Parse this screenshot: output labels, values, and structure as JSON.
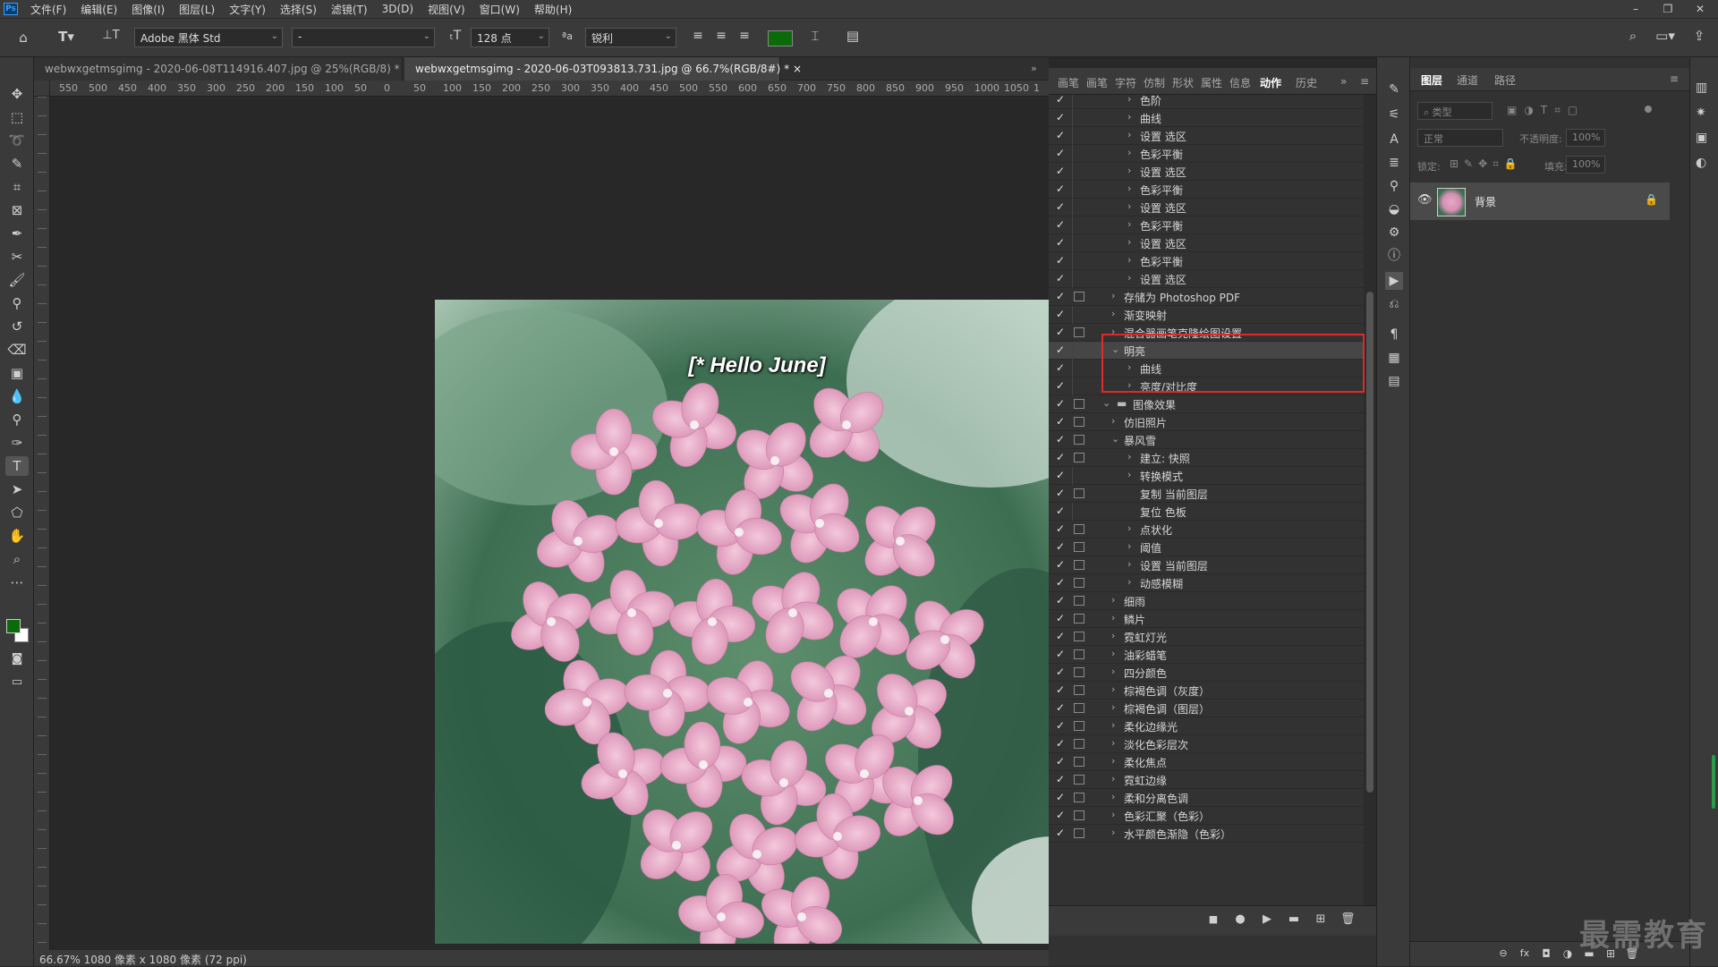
{
  "menubar": {
    "logo": "Ps",
    "items": [
      "文件(F)",
      "编辑(E)",
      "图像(I)",
      "图层(L)",
      "文字(Y)",
      "选择(S)",
      "滤镜(T)",
      "3D(D)",
      "视图(V)",
      "窗口(W)",
      "帮助(H)"
    ],
    "minimize": "–",
    "restore": "❐",
    "close": "✕"
  },
  "options": {
    "font_family": "Adobe 黑体 Std",
    "font_style": "-",
    "font_size": "128 点",
    "antialias_icon": "ªa",
    "antialias": "锐利",
    "text_color": "#0b6b0b"
  },
  "tabs": [
    {
      "label": "webwxgetmsgimg - 2020-06-08T114916.407.jpg @ 25%(RGB/8) *",
      "close": "×"
    },
    {
      "label": "webwxgetmsgimg - 2020-06-03T093813.731.jpg @ 66.7%(RGB/8#) *",
      "close": "×"
    }
  ],
  "ruler_h": [
    "550",
    "500",
    "450",
    "400",
    "350",
    "300",
    "250",
    "200",
    "150",
    "100",
    "50",
    "0",
    "50",
    "100",
    "150",
    "200",
    "250",
    "300",
    "350",
    "400",
    "450",
    "500",
    "550",
    "600",
    "650",
    "700",
    "750",
    "800",
    "850",
    "900",
    "950",
    "1000",
    "1050",
    "1"
  ],
  "canvas": {
    "overlay_text": "[* Hello June]"
  },
  "status": "66.67%  1080 像素 x 1080 像素 (72 ppi)",
  "actions_panel": {
    "tabs": [
      "画笔",
      "画笔",
      "字符",
      "仿制",
      "形状",
      "属性",
      "信息",
      "动作",
      "历史"
    ],
    "active_tab_index": 7,
    "rows": [
      {
        "label": "色阶",
        "indent": 2,
        "chev": "›",
        "box": false,
        "hl": false
      },
      {
        "label": "曲线",
        "indent": 2,
        "chev": "›",
        "box": false,
        "hl": false
      },
      {
        "label": "设置 选区",
        "indent": 2,
        "chev": "›",
        "box": false,
        "hl": false
      },
      {
        "label": "色彩平衡",
        "indent": 2,
        "chev": "›",
        "box": false,
        "hl": false
      },
      {
        "label": "设置 选区",
        "indent": 2,
        "chev": "›",
        "box": false,
        "hl": false
      },
      {
        "label": "色彩平衡",
        "indent": 2,
        "chev": "›",
        "box": false,
        "hl": false
      },
      {
        "label": "设置 选区",
        "indent": 2,
        "chev": "›",
        "box": false,
        "hl": false
      },
      {
        "label": "色彩平衡",
        "indent": 2,
        "chev": "›",
        "box": false,
        "hl": false
      },
      {
        "label": "设置 选区",
        "indent": 2,
        "chev": "›",
        "box": false,
        "hl": false
      },
      {
        "label": "色彩平衡",
        "indent": 2,
        "chev": "›",
        "box": false,
        "hl": false
      },
      {
        "label": "设置 选区",
        "indent": 2,
        "chev": "›",
        "box": false,
        "hl": false
      },
      {
        "label": "存储为 Photoshop PDF",
        "indent": 1,
        "chev": "›",
        "box": true,
        "hl": false
      },
      {
        "label": "渐变映射",
        "indent": 1,
        "chev": "›",
        "box": false,
        "hl": false
      },
      {
        "label": "混合器画笔克隆绘图设置",
        "indent": 1,
        "chev": "›",
        "box": true,
        "hl": false
      },
      {
        "label": "明亮",
        "indent": 1,
        "chev": "⌄",
        "box": false,
        "hl": true
      },
      {
        "label": "曲线",
        "indent": 2,
        "chev": "›",
        "box": false,
        "hl": false
      },
      {
        "label": "亮度/对比度",
        "indent": 2,
        "chev": "›",
        "box": false,
        "hl": false
      },
      {
        "label": "图像效果",
        "indent": 0,
        "chev": "⌄",
        "box": true,
        "hl": false,
        "folder": true
      },
      {
        "label": "仿旧照片",
        "indent": 1,
        "chev": "›",
        "box": true,
        "hl": false
      },
      {
        "label": "暴风雪",
        "indent": 1,
        "chev": "⌄",
        "box": true,
        "hl": false
      },
      {
        "label": "建立: 快照",
        "indent": 2,
        "chev": "›",
        "box": true,
        "hl": false
      },
      {
        "label": "转换模式",
        "indent": 2,
        "chev": "›",
        "box": false,
        "hl": false
      },
      {
        "label": "复制 当前图层",
        "indent": 2,
        "chev": "",
        "box": true,
        "hl": false
      },
      {
        "label": "复位 色板",
        "indent": 2,
        "chev": "",
        "box": false,
        "hl": false
      },
      {
        "label": "点状化",
        "indent": 2,
        "chev": "›",
        "box": true,
        "hl": false
      },
      {
        "label": "阈值",
        "indent": 2,
        "chev": "›",
        "box": true,
        "hl": false
      },
      {
        "label": "设置 当前图层",
        "indent": 2,
        "chev": "›",
        "box": true,
        "hl": false
      },
      {
        "label": "动感模糊",
        "indent": 2,
        "chev": "›",
        "box": true,
        "hl": false
      },
      {
        "label": "细雨",
        "indent": 1,
        "chev": "›",
        "box": true,
        "hl": false
      },
      {
        "label": "鳞片",
        "indent": 1,
        "chev": "›",
        "box": true,
        "hl": false
      },
      {
        "label": "霓虹灯光",
        "indent": 1,
        "chev": "›",
        "box": true,
        "hl": false
      },
      {
        "label": "油彩蜡笔",
        "indent": 1,
        "chev": "›",
        "box": true,
        "hl": false
      },
      {
        "label": "四分颜色",
        "indent": 1,
        "chev": "›",
        "box": true,
        "hl": false
      },
      {
        "label": "棕褐色调（灰度）",
        "indent": 1,
        "chev": "›",
        "box": true,
        "hl": false
      },
      {
        "label": "棕褐色调（图层）",
        "indent": 1,
        "chev": "›",
        "box": true,
        "hl": false
      },
      {
        "label": "柔化边缘光",
        "indent": 1,
        "chev": "›",
        "box": true,
        "hl": false
      },
      {
        "label": "淡化色彩层次",
        "indent": 1,
        "chev": "›",
        "box": true,
        "hl": false
      },
      {
        "label": "柔化焦点",
        "indent": 1,
        "chev": "›",
        "box": true,
        "hl": false
      },
      {
        "label": "霓虹边缘",
        "indent": 1,
        "chev": "›",
        "box": true,
        "hl": false
      },
      {
        "label": "柔和分离色调",
        "indent": 1,
        "chev": "›",
        "box": true,
        "hl": false
      },
      {
        "label": "色彩汇聚（色彩）",
        "indent": 1,
        "chev": "›",
        "box": true,
        "hl": false
      },
      {
        "label": "水平颜色渐隐（色彩）",
        "indent": 1,
        "chev": "›",
        "box": true,
        "hl": false
      }
    ],
    "footer_icons": [
      "■",
      "●",
      "▶",
      "▬",
      "⊞",
      "🗑"
    ]
  },
  "layers_panel": {
    "tabs": [
      "图层",
      "通道",
      "路径"
    ],
    "filter_placeholder": "类型",
    "blend_mode": "正常",
    "opacity_label": "不透明度:",
    "opacity_value": "100%",
    "lock_label": "锁定:",
    "fill_label": "填充:",
    "fill_value": "100%",
    "layer_name": "背景",
    "footer_icons": [
      "⊖",
      "fx",
      "◘",
      "◑",
      "▬",
      "⊞",
      "🗑"
    ]
  },
  "watermark": "最需教育",
  "colors": {
    "foreground": "#0b6b0b",
    "background": "#ffffff",
    "highlight_box": "#e02a2a"
  }
}
